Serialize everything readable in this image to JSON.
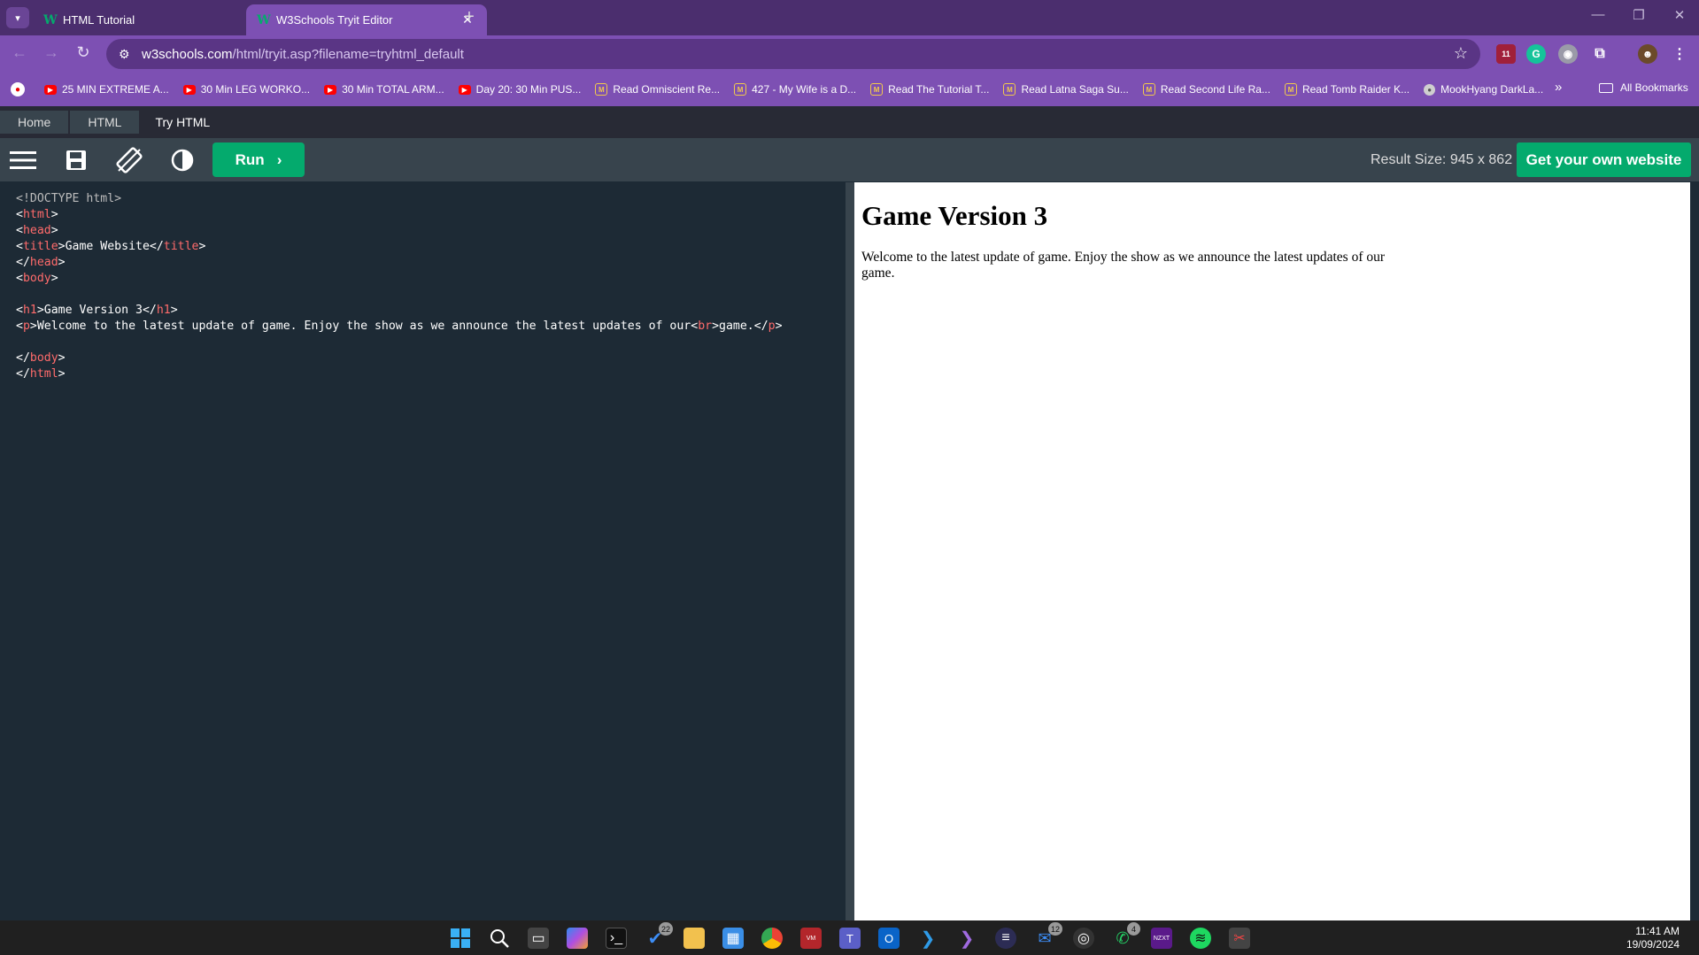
{
  "browser": {
    "tabs": [
      {
        "label": "HTML Tutorial",
        "active": false
      },
      {
        "label": "W3Schools Tryit Editor",
        "active": true
      }
    ],
    "url_host": "w3schools.com",
    "url_path": "/html/tryit.asp?filename=tryhtml_default",
    "extension_badge": "11",
    "bookmarks": [
      {
        "label": "25 MIN EXTREME A...",
        "icon": "youtube-icon"
      },
      {
        "label": "30 Min LEG WORKO...",
        "icon": "youtube-icon"
      },
      {
        "label": "30 Min TOTAL ARM...",
        "icon": "youtube-icon"
      },
      {
        "label": "Day 20: 30 Min PUS...",
        "icon": "youtube-icon"
      },
      {
        "label": "Read Omniscient Re...",
        "icon": "manga-icon"
      },
      {
        "label": "427 - My Wife is a D...",
        "icon": "manga-icon"
      },
      {
        "label": "Read The Tutorial T...",
        "icon": "manga-icon"
      },
      {
        "label": "Read Latna Saga Su...",
        "icon": "manga-icon"
      },
      {
        "label": "Read Second Life Ra...",
        "icon": "manga-icon"
      },
      {
        "label": "Read Tomb Raider K...",
        "icon": "manga-icon"
      },
      {
        "label": "MookHyang DarkLa...",
        "icon": "site-icon"
      }
    ],
    "bookmarks_overflow": "»",
    "all_bookmarks": "All Bookmarks"
  },
  "breadcrumb": [
    "Home",
    "HTML",
    "Try HTML"
  ],
  "editor_toolbar": {
    "run_label": "Run",
    "result_size": "Result Size: 945 x 862",
    "get_website_label": "Get your own website"
  },
  "code_lines": [
    [
      {
        "t": "doc",
        "v": "<!DOCTYPE html>"
      }
    ],
    [
      {
        "t": "br",
        "v": "<"
      },
      {
        "t": "tag",
        "v": "html"
      },
      {
        "t": "br",
        "v": ">"
      }
    ],
    [
      {
        "t": "br",
        "v": "<"
      },
      {
        "t": "tag",
        "v": "head"
      },
      {
        "t": "br",
        "v": ">"
      }
    ],
    [
      {
        "t": "br",
        "v": "<"
      },
      {
        "t": "tag",
        "v": "title"
      },
      {
        "t": "br",
        "v": ">"
      },
      {
        "t": "txt",
        "v": "Game Website"
      },
      {
        "t": "br",
        "v": "</"
      },
      {
        "t": "tag",
        "v": "title"
      },
      {
        "t": "br",
        "v": ">"
      }
    ],
    [
      {
        "t": "br",
        "v": "</"
      },
      {
        "t": "tag",
        "v": "head"
      },
      {
        "t": "br",
        "v": ">"
      }
    ],
    [
      {
        "t": "br",
        "v": "<"
      },
      {
        "t": "tag",
        "v": "body"
      },
      {
        "t": "br",
        "v": ">"
      }
    ],
    [],
    [
      {
        "t": "br",
        "v": "<"
      },
      {
        "t": "tag",
        "v": "h1"
      },
      {
        "t": "br",
        "v": ">"
      },
      {
        "t": "txt",
        "v": "Game Version 3"
      },
      {
        "t": "br",
        "v": "</"
      },
      {
        "t": "tag",
        "v": "h1"
      },
      {
        "t": "br",
        "v": ">"
      }
    ],
    [
      {
        "t": "br",
        "v": "<"
      },
      {
        "t": "tag",
        "v": "p"
      },
      {
        "t": "br",
        "v": ">"
      },
      {
        "t": "txt",
        "v": "Welcome to the latest update of game. Enjoy the show as we announce the latest updates of our"
      },
      {
        "t": "br",
        "v": "<"
      },
      {
        "t": "tag",
        "v": "br"
      },
      {
        "t": "br",
        "v": ">"
      },
      {
        "t": "txt",
        "v": "game."
      },
      {
        "t": "br",
        "v": "</"
      },
      {
        "t": "tag",
        "v": "p"
      },
      {
        "t": "br",
        "v": ">"
      }
    ],
    [],
    [
      {
        "t": "br",
        "v": "</"
      },
      {
        "t": "tag",
        "v": "body"
      },
      {
        "t": "br",
        "v": ">"
      }
    ],
    [
      {
        "t": "br",
        "v": "</"
      },
      {
        "t": "tag",
        "v": "html"
      },
      {
        "t": "br",
        "v": ">"
      }
    ]
  ],
  "result": {
    "heading": "Game Version 3",
    "paragraph_line1": "Welcome to the latest update of game. Enjoy the show as we announce the latest updates of our",
    "paragraph_line2": "game."
  },
  "taskbar": {
    "badges": {
      "todo": "22",
      "mail": "12",
      "whatsapp": "4"
    },
    "time": "11:41 AM",
    "date": "19/09/2024"
  },
  "colors": {
    "browser_frame": "#7d50b3",
    "w3_green": "#04aa6d",
    "editor_bg": "#1d2a35",
    "tag_red": "#ff6b6b"
  }
}
